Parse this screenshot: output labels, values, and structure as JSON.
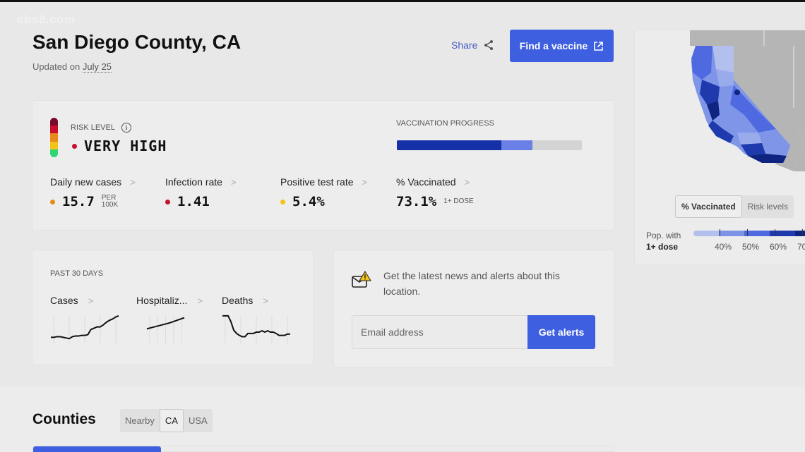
{
  "watermark": "cbs8.com",
  "header": {
    "title_bold": "San Diego",
    "title_rest": " County, CA",
    "updated_prefix": "Updated on ",
    "updated_date": "July 25",
    "share_label": "Share",
    "vaccine_button": "Find a vaccine"
  },
  "colors": {
    "accent": "#3e5fe0",
    "risk_scale": [
      "#7a0a2a",
      "#c8102e",
      "#e8891b",
      "#f2c318",
      "#2fd573"
    ],
    "very_high": "#c8102e",
    "high": "#e8891b",
    "medium": "#f2c318"
  },
  "risk": {
    "label": "RISK LEVEL",
    "value": "VERY HIGH"
  },
  "vaccination_progress": {
    "label": "VACCINATION PROGRESS",
    "fully_vaccinated_fraction": 0.565,
    "one_dose_fraction": 0.731
  },
  "metrics": [
    {
      "label": "Daily new cases",
      "value": "15.7",
      "unit_line1": "PER",
      "unit_line2": "100K",
      "dot": "high"
    },
    {
      "label": "Infection rate",
      "value": "1.41",
      "unit_line1": "",
      "unit_line2": "",
      "dot": "very_high"
    },
    {
      "label": "Positive test rate",
      "value": "5.4%",
      "unit_line1": "",
      "unit_line2": "",
      "dot": "medium"
    },
    {
      "label": "% Vaccinated",
      "value": "73.1%",
      "unit_line1": "1+ DOSE",
      "unit_line2": "",
      "dot": ""
    }
  ],
  "past30": {
    "label": "PAST 30 DAYS",
    "charts": [
      {
        "label": "Cases",
        "values": [
          3,
          3,
          3.1,
          3.1,
          3,
          2.9,
          2.8,
          3.1,
          3.2,
          3.2,
          3.3,
          3.3,
          3.4,
          4.2,
          4.4,
          4.6,
          4.6,
          4.9,
          5.3,
          5.6,
          5.8,
          6.1,
          6.3
        ]
      },
      {
        "label": "Hospitaliz...",
        "values": [
          4.3,
          4.45,
          4.6,
          4.75,
          4.9,
          5.05,
          5.2,
          5.4,
          5.6,
          5.8,
          6.0
        ]
      },
      {
        "label": "Deaths",
        "values": [
          6.3,
          6.3,
          6.3,
          5.4,
          4.1,
          3.6,
          3.3,
          3.1,
          3.1,
          3.6,
          3.6,
          3.6,
          3.8,
          3.8,
          4.0,
          3.8,
          4.0,
          3.8,
          3.8,
          3.6,
          3.3,
          3.3,
          3.3,
          3.5,
          3.5
        ]
      }
    ]
  },
  "alerts": {
    "text": "Get the latest news and alerts about this location.",
    "email_placeholder": "Email address",
    "button": "Get alerts"
  },
  "map": {
    "toggle": [
      {
        "label": "% Vaccinated",
        "active": true
      },
      {
        "label": "Risk levels",
        "active": false
      }
    ],
    "legend_line1": "Pop. with",
    "legend_line2": "1+ dose",
    "legend_ticks": [
      "40%",
      "50%",
      "60%",
      "70"
    ],
    "legend_colors": [
      "#b3c0ee",
      "#7d93e8",
      "#4f6ae0",
      "#1f3aac",
      "#0f2380"
    ]
  },
  "counties": {
    "title": "Counties",
    "tabs": [
      {
        "label": "Nearby",
        "active": false
      },
      {
        "label": "CA",
        "active": true
      },
      {
        "label": "USA",
        "active": false
      }
    ]
  }
}
